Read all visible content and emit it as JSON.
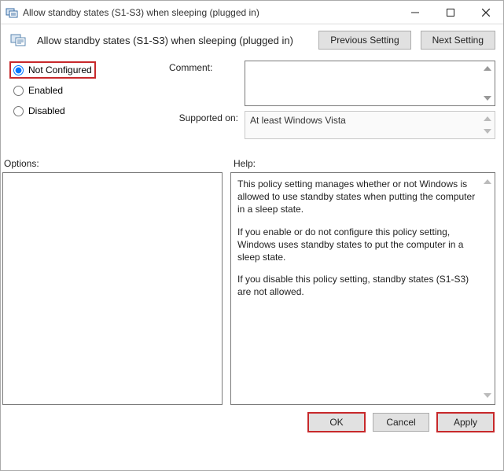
{
  "window": {
    "title": "Allow standby states (S1-S3) when sleeping (plugged in)"
  },
  "header": {
    "title": "Allow standby states (S1-S3) when sleeping (plugged in)",
    "previous_setting": "Previous Setting",
    "next_setting": "Next Setting"
  },
  "radios": {
    "not_configured": "Not Configured",
    "enabled": "Enabled",
    "disabled": "Disabled",
    "selected": "not_configured"
  },
  "form": {
    "comment_label": "Comment:",
    "comment_value": "",
    "supported_label": "Supported on:",
    "supported_value": "At least Windows Vista"
  },
  "sections": {
    "options_label": "Options:",
    "help_label": "Help:"
  },
  "help": {
    "p1": "This policy setting manages whether or not Windows is allowed to use standby states when putting the computer in a sleep state.",
    "p2": "If you enable or do not configure this policy setting, Windows uses standby states to put the computer in a sleep state.",
    "p3": "If you disable this policy setting, standby states (S1-S3) are not allowed."
  },
  "footer": {
    "ok": "OK",
    "cancel": "Cancel",
    "apply": "Apply"
  }
}
